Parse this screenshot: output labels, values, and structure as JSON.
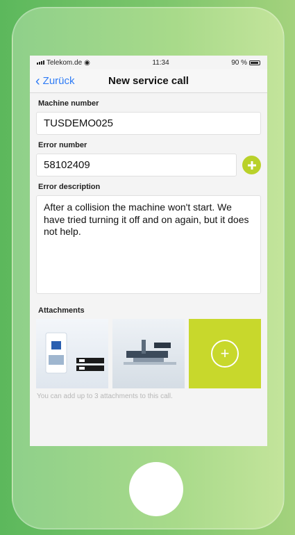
{
  "status_bar": {
    "carrier": "Telekom.de",
    "time": "11:34",
    "battery": "90 %"
  },
  "nav": {
    "back_label": "Zurück",
    "title": "New service call"
  },
  "form": {
    "machine_number_label": "Machine number",
    "machine_number_value": "TUSDEMO025",
    "error_number_label": "Error number",
    "error_number_value": "58102409",
    "error_description_label": "Error description",
    "error_description_value": "After a collision the machine won't start. We have tried turning it off and on again, but it does not help.",
    "attachments_label": "Attachments",
    "attachments_hint": "You can add up to 3 attachments to this call."
  },
  "colors": {
    "accent": "#b9d12a",
    "link": "#2f7cf6",
    "background": "#6fbf73"
  },
  "icons": {
    "back": "chevron-left-icon",
    "add_error": "plus-circle-icon",
    "add_attachment": "plus-circle-outline-icon",
    "wifi": "wifi-icon",
    "battery": "battery-icon"
  }
}
